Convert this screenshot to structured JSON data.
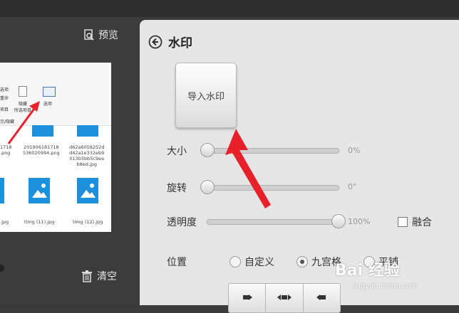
{
  "sidebar": {
    "preview_label": "预览",
    "clear_label": "清空",
    "thumbnail": {
      "ribbon": {
        "small_texts": [
          "选项",
          "重命",
          "项目"
        ],
        "hide_label": "隐藏",
        "hide_selected_label": "所选项目",
        "options_label": "选项",
        "group_label": "示/隐藏"
      },
      "files": [
        {
          "name_lines": [
            "1718",
            ".png"
          ]
        },
        {
          "name_lines": [
            "201906181718",
            "536020994.png"
          ]
        },
        {
          "name_lines": [
            "d62a6059252d",
            "d42a1e332eb9",
            "013b5bb5c9ea",
            "b8ed.jpg"
          ]
        },
        {
          "name_lines": [
            ".jpg"
          ]
        },
        {
          "name_lines": [
            "timg (11).jpg"
          ]
        },
        {
          "name_lines": [
            "timg (12).jpg"
          ]
        }
      ]
    }
  },
  "panel": {
    "title": "水印",
    "import_label": "导入水印",
    "size": {
      "label": "大小",
      "value_text": "0%",
      "level": 0
    },
    "rotate": {
      "label": "旋转",
      "value_text": "0°",
      "level": 0
    },
    "opacity": {
      "label": "透明度",
      "value_text": "100%",
      "level": 1
    },
    "blend_label": "融合",
    "position": {
      "label": "位置",
      "options": [
        "自定义",
        "九宫格",
        "平铺"
      ],
      "selected": "九宫格"
    }
  },
  "watermark": {
    "logo": "Bai 经验",
    "url": "jingyan.baidu.com"
  },
  "colors": {
    "arrow": "#e8202a",
    "panel": "#e6e6e6",
    "dark_bg": "#3a3a3a"
  }
}
